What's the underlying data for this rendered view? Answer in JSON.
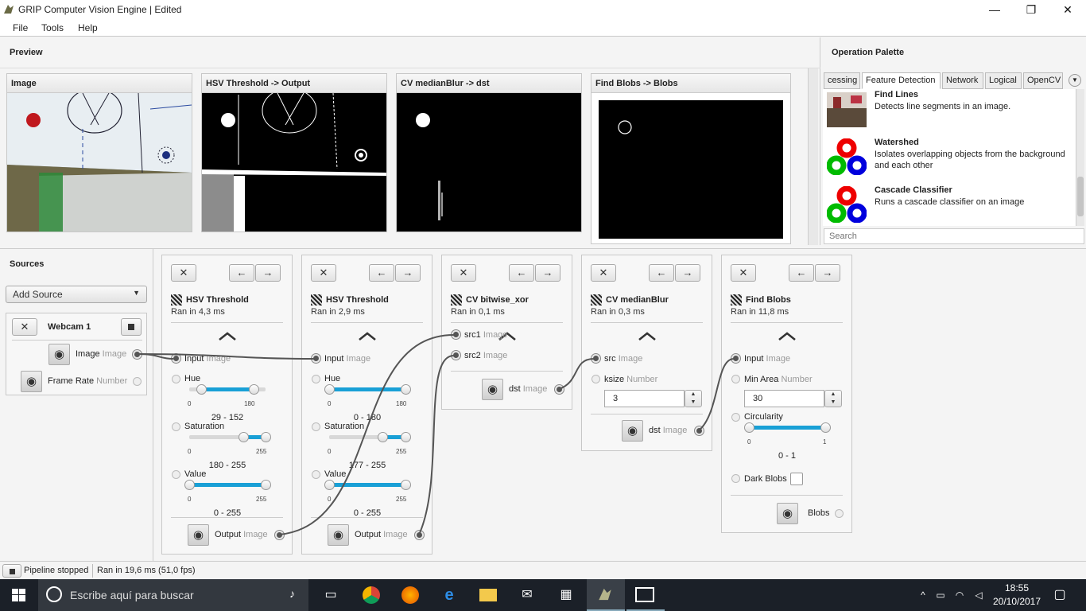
{
  "window": {
    "title": "GRIP Computer Vision Engine | Edited",
    "controls": {
      "minimize": "—",
      "maximize": "❐",
      "close": "✕"
    }
  },
  "menu": {
    "items": [
      "File",
      "Tools",
      "Help"
    ]
  },
  "preview": {
    "title": "Preview",
    "panels": [
      {
        "title": "Image"
      },
      {
        "title": "HSV Threshold -> Output"
      },
      {
        "title": "CV medianBlur -> dst"
      },
      {
        "title": "Find Blobs -> Blobs"
      }
    ]
  },
  "palette": {
    "title": "Operation Palette",
    "tabs": [
      "cessing",
      "Feature Detection",
      "Network",
      "Logical",
      "OpenCV"
    ],
    "active_tab": "Feature Detection",
    "operations": [
      {
        "name": "Find Lines",
        "description": "Detects line segments in an image."
      },
      {
        "name": "Watershed",
        "description": "Isolates overlapping objects from the background and each other"
      },
      {
        "name": "Cascade Classifier",
        "description": "Runs a cascade classifier on an image"
      }
    ],
    "search_placeholder": "Search"
  },
  "sources": {
    "title": "Sources",
    "add_source": "Add Source",
    "webcam": {
      "name": "Webcam 1",
      "outputs": [
        {
          "label": "Image",
          "type": "Image"
        },
        {
          "label": "Frame Rate",
          "type": "Number"
        }
      ]
    }
  },
  "steps": [
    {
      "name": "HSV Threshold",
      "ran": "Ran in 4,3 ms",
      "input": {
        "label": "Input",
        "type": "Image"
      },
      "params": [
        {
          "label": "Hue",
          "min": "0",
          "max": "180",
          "range": "29 - 152",
          "lo": 29,
          "hi": 152,
          "scale": 180
        },
        {
          "label": "Saturation",
          "min": "0",
          "max": "255",
          "range": "180 - 255",
          "lo": 180,
          "hi": 255,
          "scale": 255
        },
        {
          "label": "Value",
          "min": "0",
          "max": "255",
          "range": "0 - 255",
          "lo": 0,
          "hi": 255,
          "scale": 255
        }
      ],
      "output": {
        "label": "Output",
        "type": "Image"
      }
    },
    {
      "name": "HSV Threshold",
      "ran": "Ran in 2,9 ms",
      "input": {
        "label": "Input",
        "type": "Image"
      },
      "params": [
        {
          "label": "Hue",
          "min": "0",
          "max": "180",
          "range": "0 - 180",
          "lo": 0,
          "hi": 180,
          "scale": 180
        },
        {
          "label": "Saturation",
          "min": "0",
          "max": "255",
          "range": "177 - 255",
          "lo": 177,
          "hi": 255,
          "scale": 255
        },
        {
          "label": "Value",
          "min": "0",
          "max": "255",
          "range": "0 - 255",
          "lo": 0,
          "hi": 255,
          "scale": 255
        }
      ],
      "output": {
        "label": "Output",
        "type": "Image"
      }
    },
    {
      "name": "CV bitwise_xor",
      "ran": "Ran in 0,1 ms",
      "inputs": [
        {
          "label": "src1",
          "type": "Image"
        },
        {
          "label": "src2",
          "type": "Image"
        }
      ],
      "output": {
        "label": "dst",
        "type": "Image"
      }
    },
    {
      "name": "CV medianBlur",
      "ran": "Ran in 0,3 ms",
      "inputs": [
        {
          "label": "src",
          "type": "Image"
        },
        {
          "label": "ksize",
          "type": "Number"
        }
      ],
      "ksize": "3",
      "output": {
        "label": "dst",
        "type": "Image"
      }
    },
    {
      "name": "Find Blobs",
      "ran": "Ran in 11,8 ms",
      "input": {
        "label": "Input",
        "type": "Image"
      },
      "min_area": {
        "label": "Min Area",
        "type": "Number",
        "value": "30"
      },
      "circularity": {
        "label": "Circularity",
        "min": "0",
        "max": "1",
        "range": "0 - 1",
        "lo": 0,
        "hi": 1,
        "scale": 1
      },
      "dark_blobs": "Dark Blobs",
      "output": {
        "label": "Blobs"
      }
    }
  ],
  "status": {
    "pipeline": "Pipeline stopped",
    "ran": "Ran in 19,6 ms (51,0 fps)"
  },
  "taskbar": {
    "search_placeholder": "Escribe aquí para buscar",
    "time": "18:55",
    "date": "20/10/2017"
  },
  "colors": {
    "accent": "#19a0d6",
    "taskbar": "#1b2028"
  }
}
